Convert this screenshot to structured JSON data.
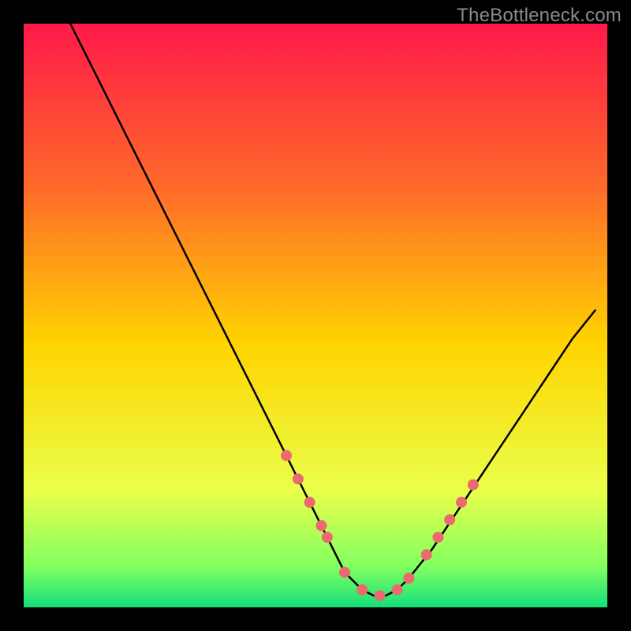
{
  "watermark": "TheBottleneck.com",
  "chart_data": {
    "type": "line",
    "title": "",
    "xlabel": "",
    "ylabel": "",
    "xlim": [
      0,
      100
    ],
    "ylim": [
      0,
      100
    ],
    "grid": false,
    "legend": false,
    "gradient_colors": {
      "top": "#ff1a4a",
      "upper_mid": "#ff6a2a",
      "mid": "#ffd400",
      "lower_mid": "#eaff4a",
      "low": "#82ff60",
      "bottom": "#13e07a"
    },
    "series": [
      {
        "name": "bottleneck-curve",
        "stroke": "#000000",
        "x": [
          8,
          12,
          16,
          20,
          24,
          28,
          32,
          36,
          40,
          44,
          48,
          52,
          55,
          58,
          60,
          62,
          64,
          66,
          70,
          74,
          78,
          82,
          86,
          90,
          94,
          98
        ],
        "y": [
          100,
          92,
          84,
          76,
          68,
          60,
          52,
          44,
          36,
          28,
          20,
          12,
          6,
          3,
          2,
          2,
          3,
          5,
          10,
          16,
          22,
          28,
          34,
          40,
          46,
          51
        ]
      },
      {
        "name": "highlight-dots",
        "stroke": "#ec6a6f",
        "type": "scatter",
        "x": [
          45,
          47,
          49,
          51,
          52,
          55,
          58,
          61,
          64,
          66,
          69,
          71,
          73,
          75,
          77
        ],
        "y": [
          26,
          22,
          18,
          14,
          12,
          6,
          3,
          2,
          3,
          5,
          9,
          12,
          15,
          18,
          21
        ]
      }
    ]
  }
}
